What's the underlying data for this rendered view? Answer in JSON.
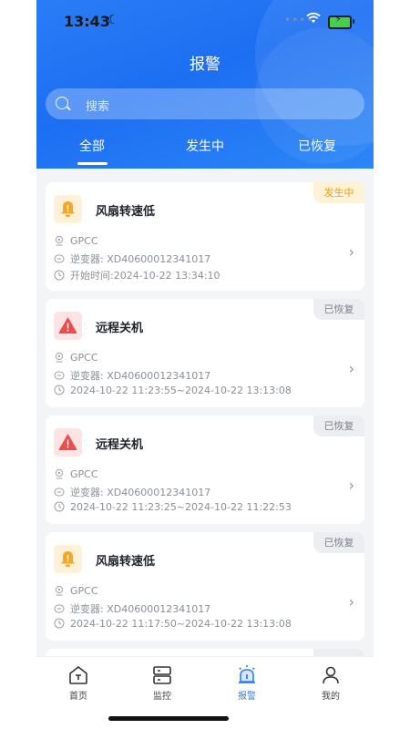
{
  "status": {
    "time": "13:43"
  },
  "header": {
    "title": "报警",
    "search_placeholder": "搜索",
    "tabs": [
      {
        "label": "全部",
        "selected": true
      },
      {
        "label": "发生中",
        "selected": false
      },
      {
        "label": "已恢复",
        "selected": false
      }
    ]
  },
  "alarms": [
    {
      "title": "风扇转速低",
      "icon": "bell-icon",
      "status": "发生中",
      "site": "GPCC",
      "inverter": "逆变器: XD40600012341017",
      "time": "开始时间:2024-10-22 13:34:10"
    },
    {
      "title": "远程关机",
      "icon": "warning-icon",
      "status": "已恢复",
      "site": "GPCC",
      "inverter": "逆变器: XD40600012341017",
      "time": "2024-10-22 11:23:55~2024-10-22 13:13:08"
    },
    {
      "title": "远程关机",
      "icon": "warning-icon",
      "status": "已恢复",
      "site": "GPCC",
      "inverter": "逆变器: XD40600012341017",
      "time": "2024-10-22 11:23:25~2024-10-22 11:22:53"
    },
    {
      "title": "风扇转速低",
      "icon": "bell-icon",
      "status": "已恢复",
      "site": "GPCC",
      "inverter": "逆变器: XD40600012341017",
      "time": "2024-10-22 11:17:50~2024-10-22 13:13:08"
    }
  ],
  "tabbar": {
    "items": [
      {
        "label": "首页",
        "icon": "home-icon"
      },
      {
        "label": "监控",
        "icon": "server-icon"
      },
      {
        "label": "报警",
        "icon": "alarm-icon",
        "active": true
      },
      {
        "label": "我的",
        "icon": "person-icon"
      }
    ]
  },
  "colors": {
    "header": "#1d6ff2",
    "accent": "#2f7cf6",
    "active_badge": "#e0a12a",
    "recovered_badge": "#7d828a"
  }
}
